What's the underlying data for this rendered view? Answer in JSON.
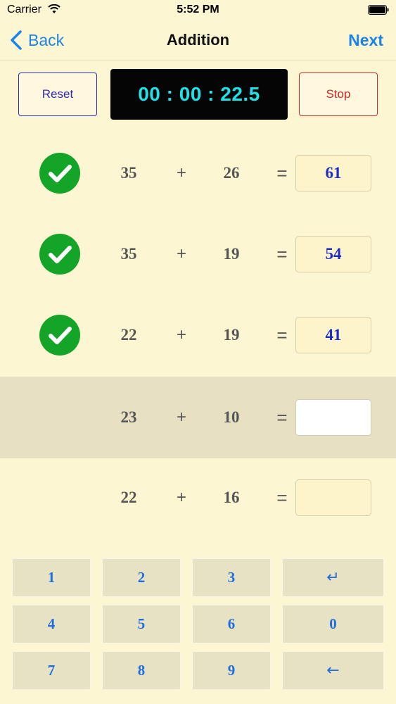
{
  "status": {
    "carrier": "Carrier",
    "time": "5:52 PM"
  },
  "nav": {
    "back_label": "Back",
    "title": "Addition",
    "next_label": "Next"
  },
  "controls": {
    "reset_label": "Reset",
    "timer": "00 : 00 : 22.5",
    "stop_label": "Stop"
  },
  "problems": [
    {
      "a": "35",
      "op": "+",
      "b": "26",
      "eq": "=",
      "answer": "61",
      "correct": true
    },
    {
      "a": "35",
      "op": "+",
      "b": "19",
      "eq": "=",
      "answer": "54",
      "correct": true
    },
    {
      "a": "22",
      "op": "+",
      "b": "19",
      "eq": "=",
      "answer": "41",
      "correct": true
    },
    {
      "a": "23",
      "op": "+",
      "b": "10",
      "eq": "=",
      "answer": "",
      "correct": false,
      "active": true
    },
    {
      "a": "22",
      "op": "+",
      "b": "16",
      "eq": "=",
      "answer": "",
      "correct": false
    }
  ],
  "keypad": {
    "k1": "1",
    "k2": "2",
    "k3": "3",
    "enter": "↵",
    "k4": "4",
    "k5": "5",
    "k6": "6",
    "k0": "0",
    "k7": "7",
    "k8": "8",
    "k9": "9",
    "backspace": "←"
  },
  "colors": {
    "background": "#fdf6d2",
    "accent": "#1a84e8",
    "correct": "#13a428",
    "timer_text": "#1ee3e8",
    "answer_text": "#1d2cc8",
    "reset": "#2a2ab8",
    "stop": "#c8282a"
  }
}
